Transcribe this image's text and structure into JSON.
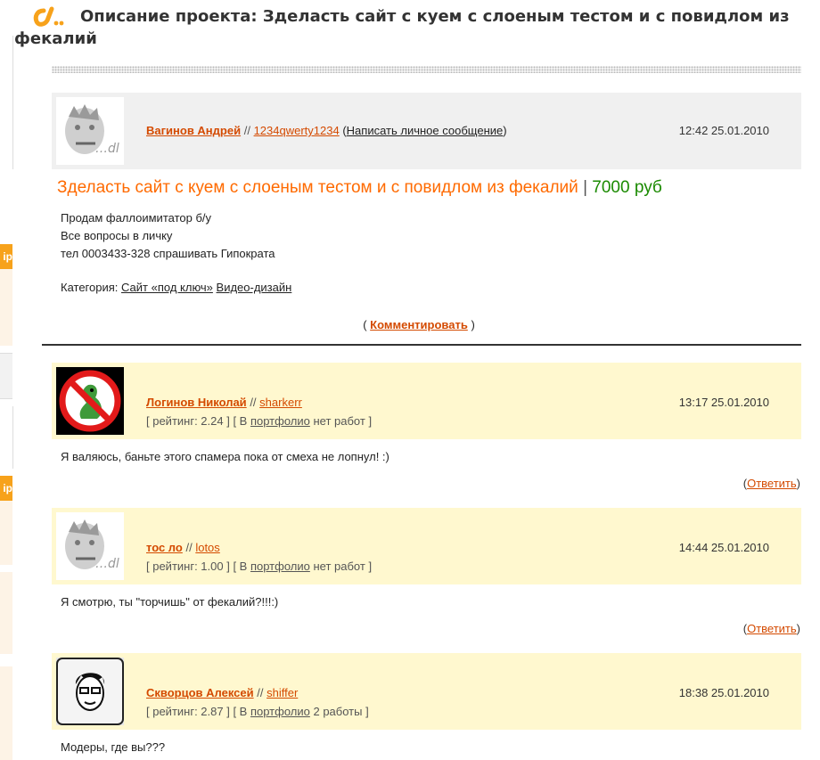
{
  "page": {
    "title": "Описание проекта: Зделасть сайт с куем с слоеным тестом и с повидлом из фекалий"
  },
  "sidebar_fragments": [
    {
      "label": "ip"
    },
    {
      "label": "ip"
    }
  ],
  "project": {
    "author": {
      "name": "Вагинов Андрей",
      "separator": "//",
      "login": "1234qwerty1234",
      "pm_open": "(",
      "pm_label": "Написать личное сообщение",
      "pm_close": ")",
      "time": "12:42 25.01.2010",
      "avatar": "default-avatar-dl"
    },
    "name": "Зделасть сайт с куем с слоеным тестом и с повидлом из фекалий",
    "bar": "|",
    "price": "7000 руб",
    "description": [
      "Продам фаллоимитатор б/у",
      "Все вопросы в личку",
      "тел 0003433-328 спрашивать Гипократа"
    ],
    "category_label": "Категория:",
    "categories": [
      "Сайт «под ключ»",
      "Видео-дизайн"
    ],
    "comment_open": "(",
    "comment_label": "Комментировать",
    "comment_close": ")"
  },
  "comments": [
    {
      "name": "Логинов Николай",
      "separator": "//",
      "login": "sharkerr",
      "time": "13:17 25.01.2010",
      "rating_prefix": "[ рейтинг: 2.24 ] [ В",
      "portfolio_label": "портфолио",
      "rating_suffix": "нет работ ]",
      "text": "Я валяюсь, баньте этого спамера пока от смеха не лопнул! :)",
      "reply_open": "(",
      "reply_label": "Ответить",
      "reply_close": ")",
      "avatar": "no-dino-avatar"
    },
    {
      "name": "тос ло",
      "separator": "//",
      "login": "lotos",
      "time": "14:44 25.01.2010",
      "rating_prefix": "[ рейтинг: 1.00 ] [ В",
      "portfolio_label": "портфолио",
      "rating_suffix": "нет работ ]",
      "text": "Я смотрю, ты \"торчишь\" от фекалий?!!!:)",
      "reply_open": "(",
      "reply_label": "Ответить",
      "reply_close": ")",
      "avatar": "default-avatar-dl"
    },
    {
      "name": "Скворцов Алексей",
      "separator": "//",
      "login": "shiffer",
      "time": "18:38 25.01.2010",
      "rating_prefix": "[ рейтинг: 2.87 ] [ В",
      "portfolio_label": "портфолио",
      "rating_suffix": "2 работы ]",
      "text": "Модеры, где вы???",
      "avatar": "sketch-face-avatar"
    }
  ],
  "colors": {
    "accent_orange": "#ff6a00",
    "link_orange": "#d44a00",
    "price_green": "#1a8a00",
    "comment_bg": "#fff8cf",
    "author_bg": "#f0f0f0"
  }
}
